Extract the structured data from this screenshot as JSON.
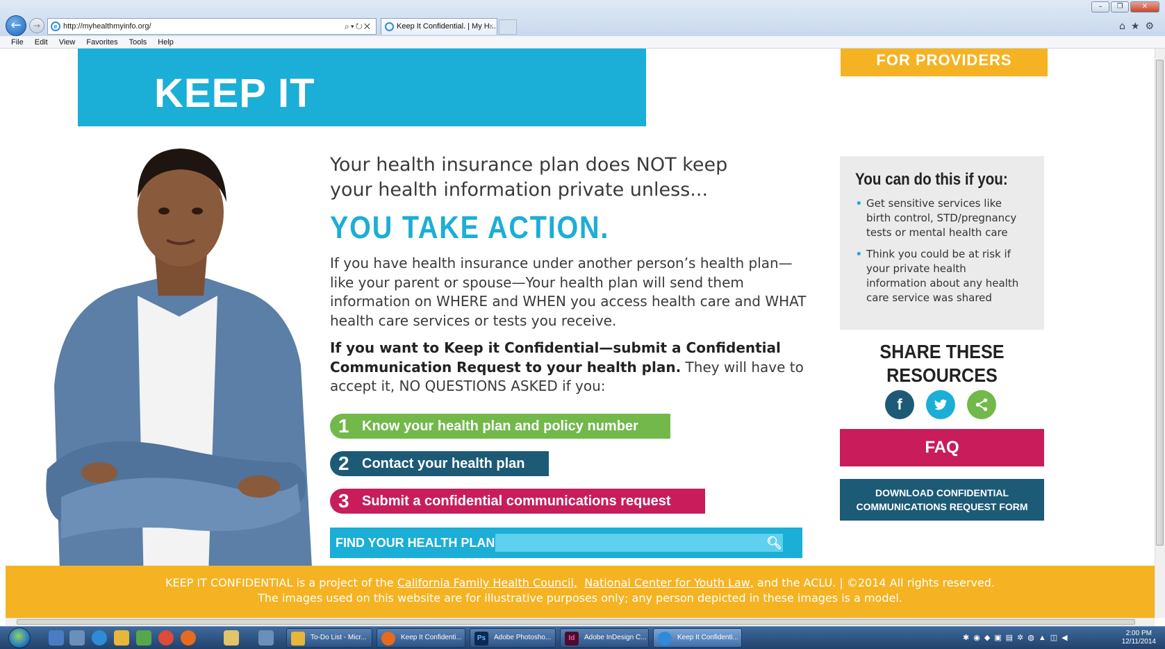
{
  "browser": {
    "url": "http://myhealthmyinfo.org/",
    "tab_title": "Keep It Confidential. | My H...",
    "menu": [
      "File",
      "Edit",
      "View",
      "Favorites",
      "Tools",
      "Help"
    ]
  },
  "page": {
    "hero_title": "KEEP IT CONFIDENTIAL.",
    "providers_button": "FOR PROVIDERS",
    "intro": "Your health insurance plan does NOT keep your health information private unless...",
    "action_heading": "YOU TAKE ACTION.",
    "paragraph1": "If you have health insurance under another person’s health plan—like your parent or spouse—Your health plan will send them information on WHERE and WHEN you access health care and WHAT health care services or tests you receive.",
    "paragraph2_bold": "If you want to Keep it Confidential—submit a Confidential Communication Request to your health plan.",
    "paragraph2_rest": " They will have to accept it, NO QUESTIONS ASKED if you:",
    "steps": [
      {
        "num": "1",
        "label": "Know your health plan and policy number"
      },
      {
        "num": "2",
        "label": "Contact your health plan"
      },
      {
        "num": "3",
        "label": "Submit a confidential communications request"
      }
    ],
    "find_plan_label": "FIND YOUR HEALTH PLAN",
    "find_plan_placeholder": ""
  },
  "sidebar": {
    "you_can_title": "You can do this if you:",
    "you_can_items": [
      "Get sensitive services like birth control, STD/pregnancy tests or mental health care",
      "Think you could be at risk if your private health information about any health care service was shared"
    ],
    "share_title_line1": "SHARE THESE",
    "share_title_line2": "RESOURCES",
    "faq_button": "FAQ",
    "download_line1": "DOWNLOAD CONFIDENTIAL",
    "download_line2": "COMMUNICATIONS REQUEST FORM"
  },
  "footer": {
    "line1_prefix": "KEEP IT CONFIDENTIAL is a project of the ",
    "link1": "California Family Health Council,",
    "link2": "National Center for Youth Law,",
    "line1_suffix": " and the ACLU. | ©2014 All rights reserved.",
    "line2": "The images used on this website are for illustrative purposes only; any person depicted in these images is a model."
  },
  "taskbar": {
    "tasks": [
      "To-Do List - Micr...",
      "Keep It Confidenti...",
      "Adobe Photosho...",
      "Adobe InDesign C...",
      "Keep It Confidenti..."
    ],
    "time": "2:00 PM",
    "date": "12/11/2014"
  },
  "colors": {
    "cyan": "#1baed6",
    "gold": "#f5b323",
    "green": "#72b84a",
    "navy": "#1d5a76",
    "magenta": "#c81d5a"
  }
}
